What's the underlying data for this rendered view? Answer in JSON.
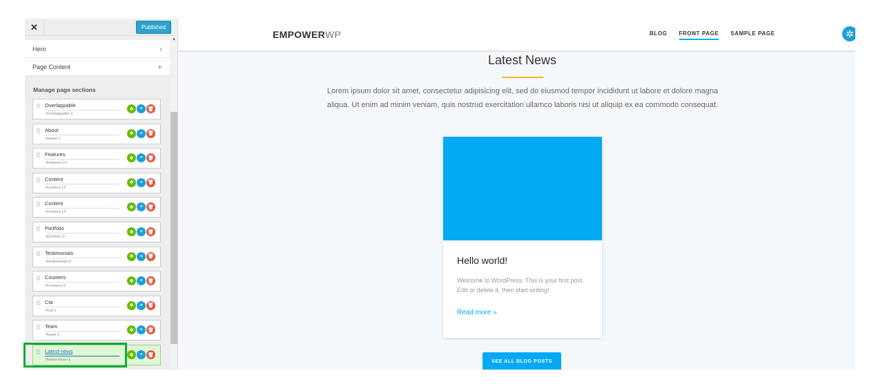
{
  "customizer": {
    "close_glyph": "✕",
    "publish_label": "Published",
    "panels": [
      {
        "label": "Hero",
        "icon": "chevron-right-icon",
        "glyph": "›"
      },
      {
        "label": "Page Content",
        "icon": "plus-icon",
        "glyph": "+"
      }
    ],
    "manage_title": "Manage page sections",
    "sections": [
      {
        "name": "Overlappable",
        "anchor": "#overlappable-1"
      },
      {
        "name": "About",
        "anchor": "#about-1"
      },
      {
        "name": "Features",
        "anchor": "#features-10"
      },
      {
        "name": "Content",
        "anchor": "#content-13"
      },
      {
        "name": "Content",
        "anchor": "#content-14"
      },
      {
        "name": "Portfolio",
        "anchor": "#portfolio-3"
      },
      {
        "name": "Testimonials",
        "anchor": "#testimonials-5"
      },
      {
        "name": "Counters",
        "anchor": "#counters-2"
      },
      {
        "name": "Cta",
        "anchor": "#cta-1"
      },
      {
        "name": "Team",
        "anchor": "#team-2"
      },
      {
        "name": "Latest-news",
        "anchor": "#latest-news-1"
      }
    ],
    "action_glyphs": {
      "settings": "✲",
      "list": "≡",
      "delete": "🗑"
    }
  },
  "site": {
    "logo_bold": "EMPOWER",
    "logo_light": "WP",
    "nav": [
      "BLOG",
      "FRONT PAGE",
      "SAMPLE PAGE"
    ],
    "fab_glyph": "✲",
    "section_title": "Latest News",
    "lead": "Lorem ipsum dolor sit amet, consectetur adipisicing elit, sed do eiusmod tempor incididunt ut labore et dolore magna aliqua. Ut enim ad minim veniam, quis nostrud exercitation ullamco laboris nisi ut aliquip ex ea commodo consequat.",
    "post": {
      "title": "Hello world!",
      "excerpt": "Welcome to WordPress. This is your first post. Edit or delete it, then start writing!",
      "read_more": "Read more »"
    },
    "see_all": "SEE ALL BLOG POSTS"
  },
  "colors": {
    "accent": "#03a9f4",
    "publish": "#2ea2cc",
    "underline": "#f0b429",
    "focus": "#14a83b"
  }
}
